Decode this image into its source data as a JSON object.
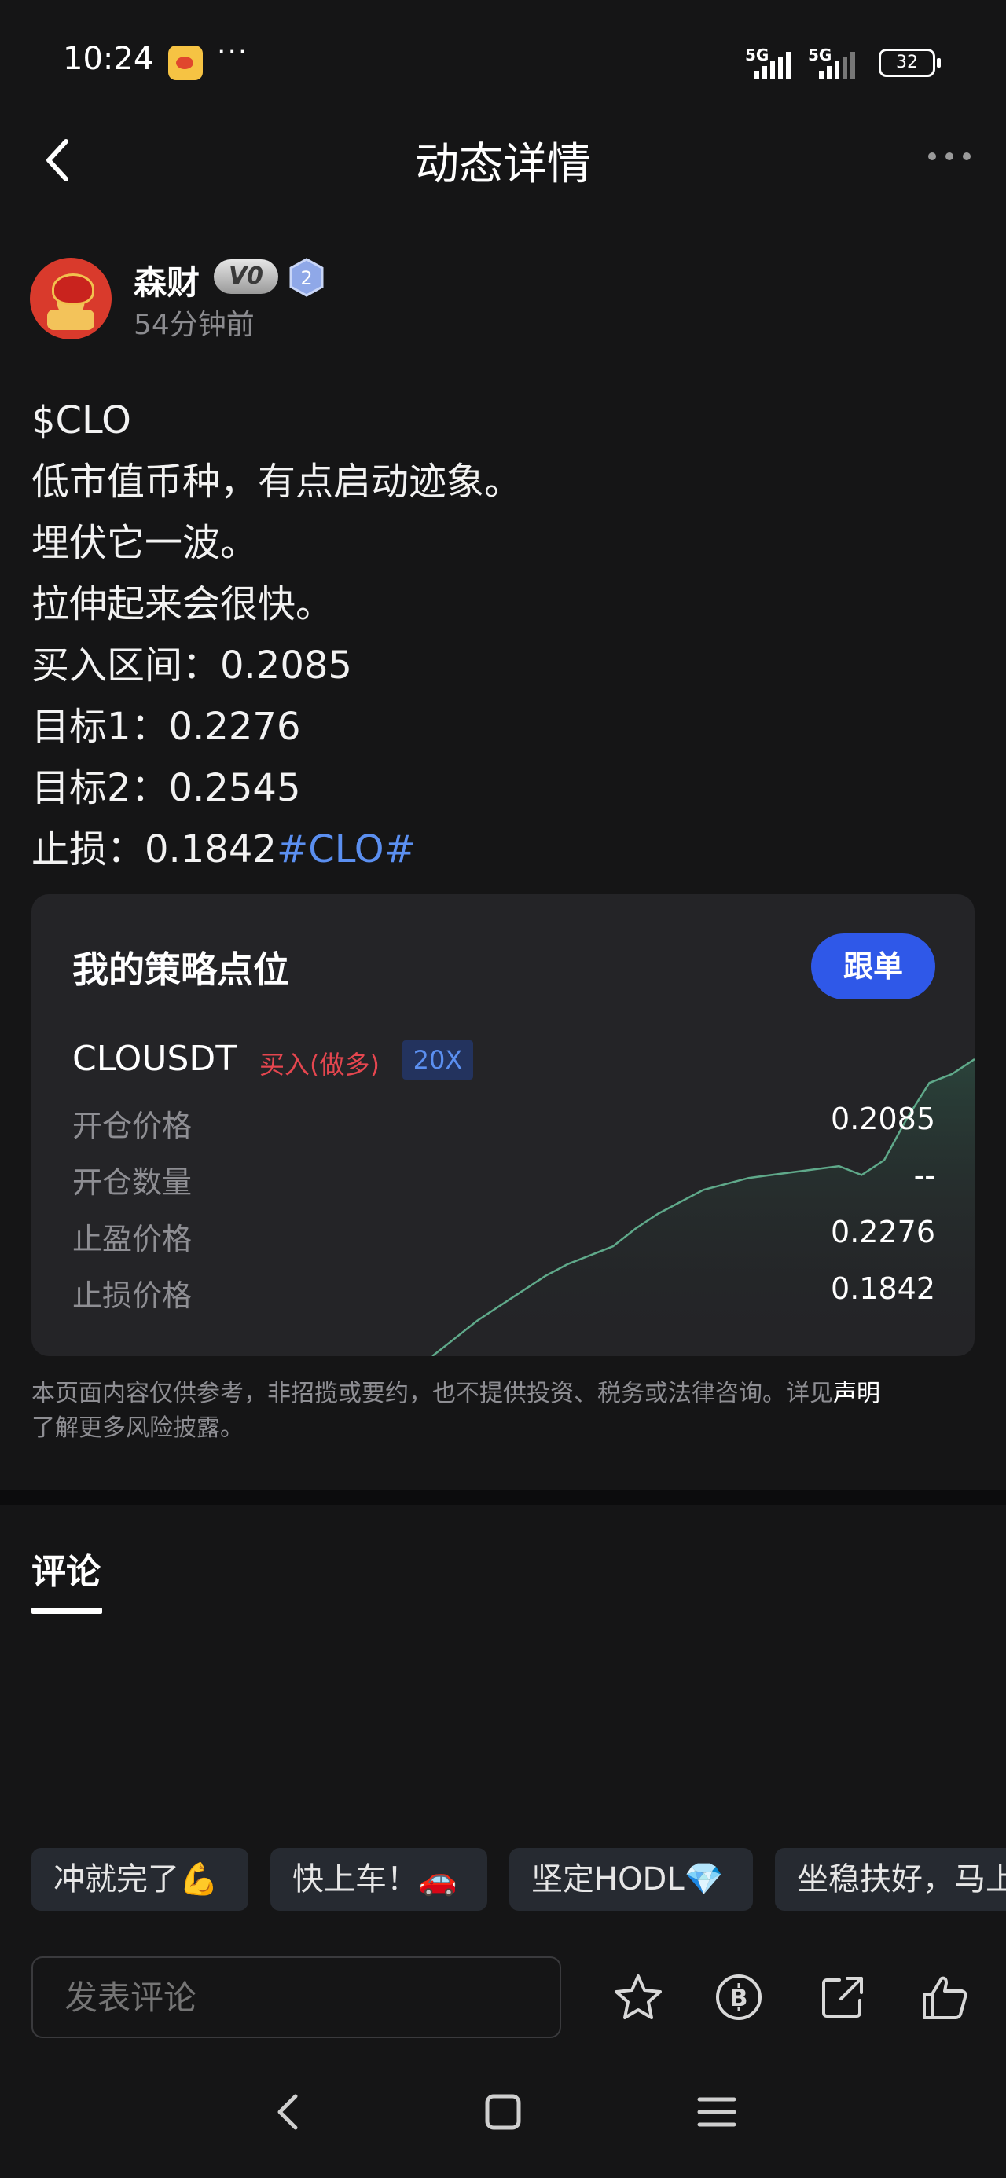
{
  "status_bar": {
    "time": "10:24",
    "dots": "···",
    "network_1": "5G",
    "network_2": "5G",
    "battery": "32"
  },
  "header": {
    "title": "动态详情"
  },
  "author": {
    "name": "森财",
    "vip_badge": "V0",
    "level_badge": "2",
    "posted": "54分钟前"
  },
  "post": {
    "lines": [
      "$CLO",
      "低市值币种，有点启动迹象。",
      "埋伏它一波。",
      "拉伸起来会很快。",
      "买入区间：0.2085",
      "目标1：0.2276",
      "目标2：0.2545",
      "止损：0.1842"
    ],
    "hashtag": "#CLO#"
  },
  "strategy": {
    "title": "我的策略点位",
    "follow_label": "跟单",
    "symbol": "CLOUSDT",
    "side": "买入(做多)",
    "leverage": "20X",
    "rows": [
      {
        "label": "开仓价格",
        "value": "0.2085"
      },
      {
        "label": "开仓数量",
        "value": "--"
      },
      {
        "label": "止盈价格",
        "value": "0.2276"
      },
      {
        "label": "止损价格",
        "value": "0.1842"
      }
    ],
    "trend": [
      0.0,
      0.06,
      0.12,
      0.17,
      0.22,
      0.27,
      0.31,
      0.34,
      0.37,
      0.43,
      0.48,
      0.52,
      0.56,
      0.58,
      0.6,
      0.61,
      0.62,
      0.63,
      0.64,
      0.61,
      0.66,
      0.8,
      0.92,
      0.95,
      1.0
    ],
    "trend_color": "#5fa98a"
  },
  "disclaimer": {
    "text": "本页面内容仅供参考，非招揽或要约，也不提供投资、税务或法律咨询。详见",
    "link": "声明",
    "text2": "了解更多风险披露。"
  },
  "comments": {
    "tab_label": "评论"
  },
  "quick_replies": [
    "冲就完了💪",
    "快上车！🚗",
    "坚定HODL💎",
    "坐稳扶好，马上"
  ],
  "action_bar": {
    "placeholder": "发表评论",
    "icons": [
      "star-icon",
      "coin-icon",
      "share-icon",
      "thumbs-up-icon"
    ]
  },
  "colors": {
    "background": "#151516",
    "card": "#242427",
    "accent_blue": "#2f58e8",
    "buy_red": "#e5464f",
    "hashtag": "#5b8ff0"
  }
}
